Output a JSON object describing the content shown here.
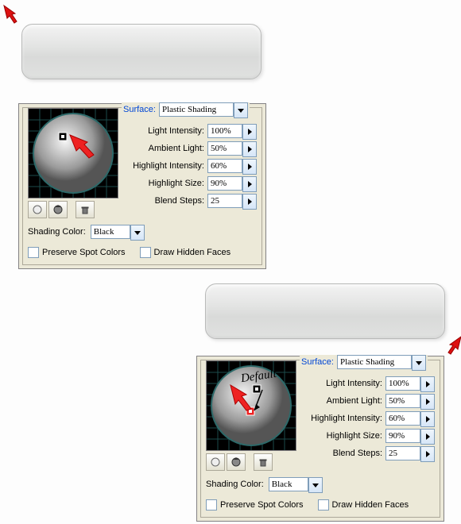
{
  "panel1": {
    "surface_label": "Surface:",
    "surface_value": "Plastic Shading",
    "params": [
      {
        "label": "Light Intensity:",
        "value": "100%"
      },
      {
        "label": "Ambient Light:",
        "value": "50%"
      },
      {
        "label": "Highlight Intensity:",
        "value": "60%"
      },
      {
        "label": "Highlight Size:",
        "value": "90%"
      },
      {
        "label": "Blend Steps:",
        "value": "25"
      }
    ],
    "shading_color_label": "Shading Color:",
    "shading_color_value": "Black",
    "preserve_spot_label": "Preserve Spot Colors",
    "draw_hidden_label": "Draw Hidden Faces"
  },
  "panel2": {
    "surface_label": "Surface:",
    "surface_value": "Plastic Shading",
    "annotation": "Default",
    "params": [
      {
        "label": "Light Intensity:",
        "value": "100%"
      },
      {
        "label": "Ambient Light:",
        "value": "50%"
      },
      {
        "label": "Highlight Intensity:",
        "value": "60%"
      },
      {
        "label": "Highlight Size:",
        "value": "90%"
      },
      {
        "label": "Blend Steps:",
        "value": "25"
      }
    ],
    "shading_color_label": "Shading Color:",
    "shading_color_value": "Black",
    "preserve_spot_label": "Preserve Spot Colors",
    "draw_hidden_label": "Draw Hidden Faces"
  }
}
